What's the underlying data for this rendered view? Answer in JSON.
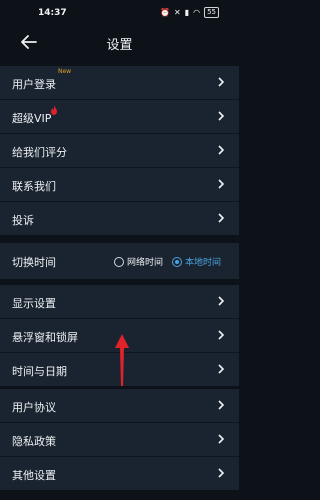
{
  "status": {
    "time": "14:37",
    "battery": "55"
  },
  "header": {
    "title": "设置"
  },
  "group1": [
    {
      "label": "用户登录",
      "badge": "New"
    },
    {
      "label": "超级VIP"
    },
    {
      "label": "给我们评分"
    },
    {
      "label": "联系我们"
    },
    {
      "label": "投诉"
    }
  ],
  "time_switch": {
    "label": "切换时间",
    "options": [
      "网络时间",
      "本地时间"
    ],
    "selected": "本地时间"
  },
  "group3": [
    {
      "label": "显示设置"
    },
    {
      "label": "悬浮窗和锁屏"
    },
    {
      "label": "时间与日期"
    }
  ],
  "group4": [
    {
      "label": "用户协议"
    },
    {
      "label": "隐私政策"
    },
    {
      "label": "其他设置"
    }
  ],
  "colors": {
    "accent": "#4aa3e0",
    "annotation": "#e0222a",
    "badge": "#e0a12a"
  }
}
